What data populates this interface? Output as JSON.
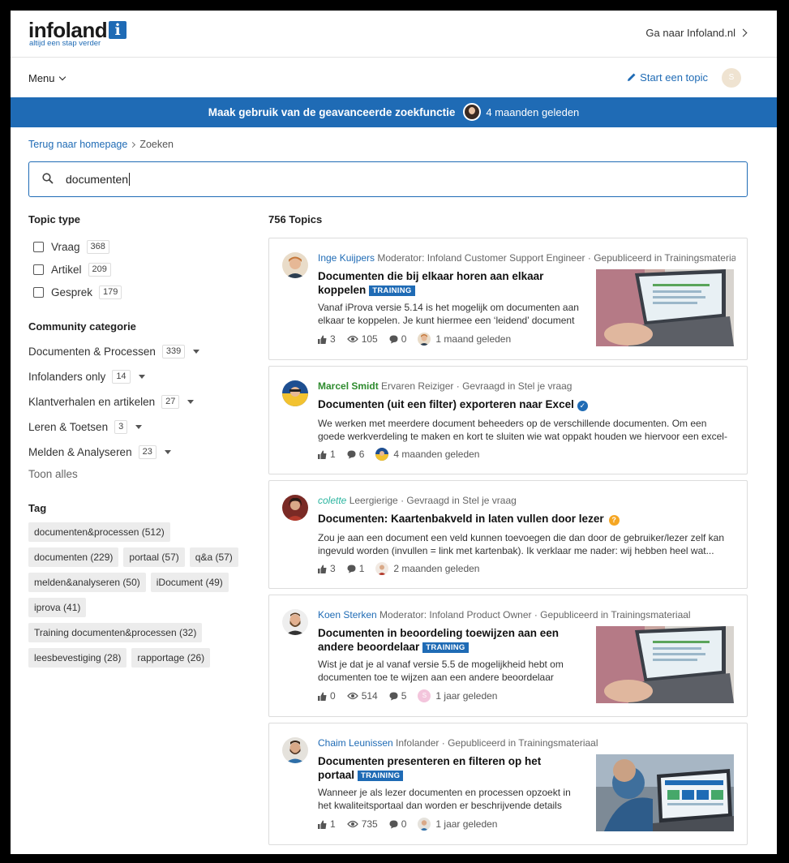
{
  "header": {
    "logo_text": "infoland",
    "logo_letter": "i",
    "logo_tagline": "altijd een stap verder",
    "goto_link": "Ga naar Infoland.nl"
  },
  "nav": {
    "menu_label": "Menu",
    "start_topic": "Start een topic",
    "user_initial": "S"
  },
  "banner": {
    "title": "Maak gebruik van de geavanceerde zoekfunctie",
    "time": "4 maanden geleden"
  },
  "breadcrumb": {
    "home": "Terug naar homepage",
    "current": "Zoeken"
  },
  "search": {
    "value": "documenten"
  },
  "filters": {
    "topic_type_heading": "Topic type",
    "topic_types": [
      {
        "label": "Vraag",
        "count": "368"
      },
      {
        "label": "Artikel",
        "count": "209"
      },
      {
        "label": "Gesprek",
        "count": "179"
      }
    ],
    "category_heading": "Community categorie",
    "categories": [
      {
        "label": "Documenten & Processen",
        "count": "339"
      },
      {
        "label": "Infolanders only",
        "count": "14"
      },
      {
        "label": "Klantverhalen en artikelen",
        "count": "27"
      },
      {
        "label": "Leren & Toetsen",
        "count": "3"
      },
      {
        "label": "Melden & Analyseren",
        "count": "23"
      }
    ],
    "show_all": "Toon alles",
    "tag_heading": "Tag",
    "tags": [
      "documenten&processen (512)",
      "documenten (229)",
      "portaal (57)",
      "q&a (57)",
      "melden&analyseren (50)",
      "iDocument (49)",
      "iprova (41)",
      "Training documenten&processen (32)",
      "leesbevestiging (28)",
      "rapportage (26)"
    ]
  },
  "results": {
    "total": "756 Topics",
    "training_badge": "TRAINING",
    "items": [
      {
        "author": "Inge Kuijpers",
        "meta": " Moderator: Infoland Customer Support Engineer · Gepubliceerd in Trainingsmateria...",
        "title": "Documenten die bij elkaar horen aan elkaar koppelen",
        "excerpt": "Vanaf iProva versie 5.14 is het mogelijk om documenten aan elkaar te koppelen. Je kunt hiermee een ‘leidend’ document en...",
        "likes": "3",
        "views": "105",
        "comments": "0",
        "time": "1 maand geleden"
      },
      {
        "author": "Marcel Smidt",
        "meta": " Ervaren Reiziger · Gevraagd in Stel je vraag",
        "title": "Documenten (uit een filter) exporteren naar Excel",
        "excerpt": "We werken met meerdere document beheeders op de verschillende documenten. Om een goede werkverdeling te maken en kort te sluiten wie wat oppakt houden we hiervoor een excel-lijst bij. ...",
        "likes": "1",
        "comments": "6",
        "time": "4 maanden geleden"
      },
      {
        "author": "colette",
        "meta": " Leergierige · Gevraagd in Stel je vraag",
        "title": "Documenten: Kaartenbakveld in laten vullen door lezer",
        "excerpt": "Zou je aan een document een veld kunnen toevoegen die dan door de gebruiker/lezer zelf kan ingevuld worden (invullen = link met kartenbak). Ik verklaar me nader: wij hebben heel wat...",
        "likes": "3",
        "comments": "1",
        "time": "2 maanden geleden"
      },
      {
        "author": "Koen Sterken",
        "meta": " Moderator: Infoland Product Owner · Gepubliceerd in Trainingsmateriaal",
        "title": "Documenten in beoordeling toewijzen aan een andere beoordelaar",
        "excerpt": "Wist je dat je al vanaf versie 5.5 de mogelijkheid hebt om documenten toe te wijzen aan een andere beoordelaar terwijl...",
        "likes": "0",
        "views": "514",
        "comments": "5",
        "time": "1 jaar geleden",
        "mini_initial": "S"
      },
      {
        "author": "Chaim Leunissen",
        "meta": " Infolander · Gepubliceerd in Trainingsmateriaal",
        "title": "Documenten presenteren en filteren op het portaal",
        "excerpt": "Wanneer je als lezer documenten en processen opzoekt in het kwaliteitsportaal dan worden er beschrijvende details van...",
        "likes": "1",
        "views": "735",
        "comments": "0",
        "time": "1 jaar geleden"
      }
    ]
  }
}
